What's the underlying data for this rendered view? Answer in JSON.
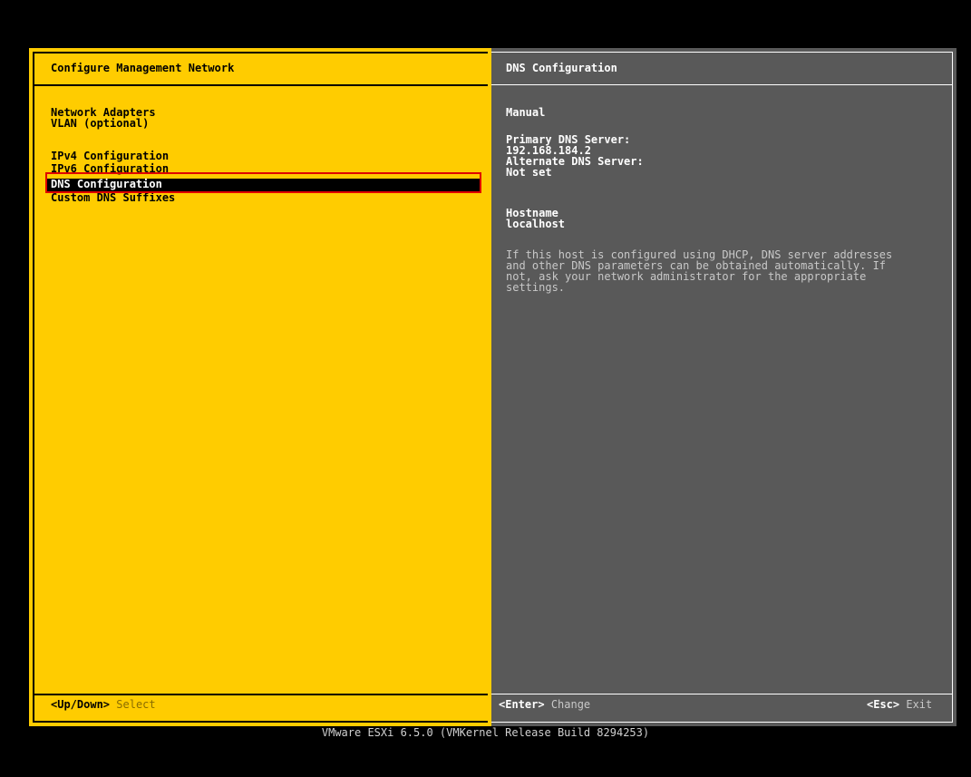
{
  "left": {
    "title": "Configure Management Network",
    "menu": {
      "network_adapters": "Network Adapters",
      "vlan": "VLAN (optional)",
      "ipv4": "IPv4 Configuration",
      "ipv6": "IPv6 Configuration",
      "dns": "DNS Configuration",
      "custom_dns_suffixes": "Custom DNS Suffixes"
    },
    "hint_key": "<Up/Down>",
    "hint_action": "Select"
  },
  "right": {
    "title": "DNS Configuration",
    "mode": "Manual",
    "primary_label": "Primary DNS Server:",
    "primary_value": "192.168.184.2",
    "alternate_label": "Alternate DNS Server:",
    "alternate_value": "Not set",
    "hostname_label": "Hostname",
    "hostname_value": "localhost",
    "help": {
      "line1": "If this host is configured using DHCP, DNS server addresses",
      "line2": "and other DNS parameters can be obtained automatically. If",
      "line3": "not, ask your network administrator for the appropriate",
      "line4": "settings."
    },
    "enter_key": "<Enter>",
    "enter_action": "Change",
    "esc_key": "<Esc>",
    "esc_action": "Exit"
  },
  "footer": "VMware ESXi 6.5.0 (VMKernel Release Build 8294253)",
  "colors": {
    "left_bg": "#ffcc00",
    "right_bg": "#595959",
    "selection_bg": "#000000",
    "highlight_border": "#e00000"
  }
}
